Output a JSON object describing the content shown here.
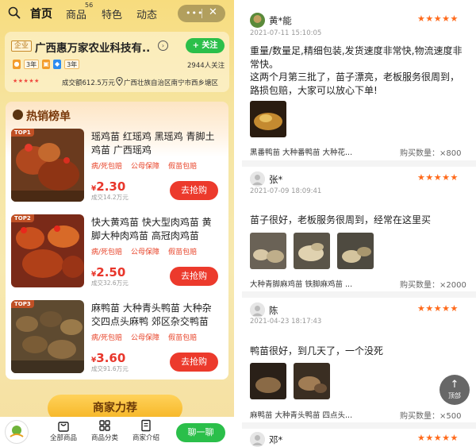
{
  "nav": {
    "tabs": [
      {
        "label": "首页"
      },
      {
        "label": "商品"
      },
      {
        "label": "特色"
      },
      {
        "label": "动态"
      }
    ],
    "goods_badge": "56",
    "capsule_more": "•••",
    "capsule_close": "✕"
  },
  "shop": {
    "badge": "企业",
    "name": "广西惠万家农业科技有...",
    "follow_label": "+ 关注",
    "year_badge_1": "3年",
    "year_badge_2": "3年",
    "followers": "2944人关注",
    "turnover": "成交额612.5万元",
    "location": "广西壮族自治区南宁市西乡塘区"
  },
  "hotlist": {
    "title": "热销榜单",
    "products": [
      {
        "rank": "TOP1",
        "title": "瑶鸡苗 红瑶鸡 黑瑶鸡 青脚土鸡苗 广西瑶鸡",
        "tags": [
          "病/死包赔",
          "公母保障",
          "假苗包赔"
        ],
        "currency": "¥",
        "price": "2.30",
        "sold": "成交14.2万元",
        "buy_label": "去抢购"
      },
      {
        "rank": "TOP2",
        "title": "快大黄鸡苗 快大型肉鸡苗 黄脚大种肉鸡苗 高冠肉鸡苗",
        "tags": [
          "病/死包赔",
          "公母保障",
          "假苗包赔"
        ],
        "currency": "¥",
        "price": "2.50",
        "sold": "成交32.6万元",
        "buy_label": "去抢购"
      },
      {
        "rank": "TOP3",
        "title": "麻鸭苗 大种青头鸭苗 大种杂交四点头麻鸭 郊区杂交鸭苗",
        "tags": [
          "病/死包赔",
          "公母保障",
          "假苗包赔"
        ],
        "currency": "¥",
        "price": "3.60",
        "sold": "成交91.6万元",
        "buy_label": "去抢购"
      }
    ]
  },
  "recommend_label": "商家力荐",
  "bottom_bar": {
    "all_goods": "全部商品",
    "category": "商品分类",
    "intro": "商家介绍",
    "chat": "聊一聊"
  },
  "reviews": [
    {
      "name": "黄*能",
      "stars": "★★★★★",
      "time": "2021-07-11 15:10:05",
      "text": "重量/数量足,精细包装,发货速度非常快,物流速度非常快。\n这两个月第三批了，苗子漂亮，老板服务很周到，路损包赔，大家可以放心下单!",
      "spec": "黑番鸭苗 大种番鸭苗 大种花...",
      "qty": "购买数量：×800"
    },
    {
      "name": "张*",
      "stars": "★★★★★",
      "time": "2021-07-09 18:09:41",
      "text": "苗子很好，老板服务很周到，经常在这里买",
      "spec": "大种青脚麻鸡苗 铁脚麻鸡苗 ...",
      "qty": "购买数量：×2000"
    },
    {
      "name": "陈",
      "stars": "★★★★★",
      "time": "2021-04-23 18:17:43",
      "text": "鸭苗很好，到几天了，一个没死",
      "spec": "麻鸭苗 大种青头鸭苗 四点头...",
      "qty": "购买数量：×500"
    },
    {
      "name": "邓*",
      "stars": "★★★★★"
    }
  ],
  "back_to_top": {
    "arrow": "↑",
    "label": "顶部"
  }
}
